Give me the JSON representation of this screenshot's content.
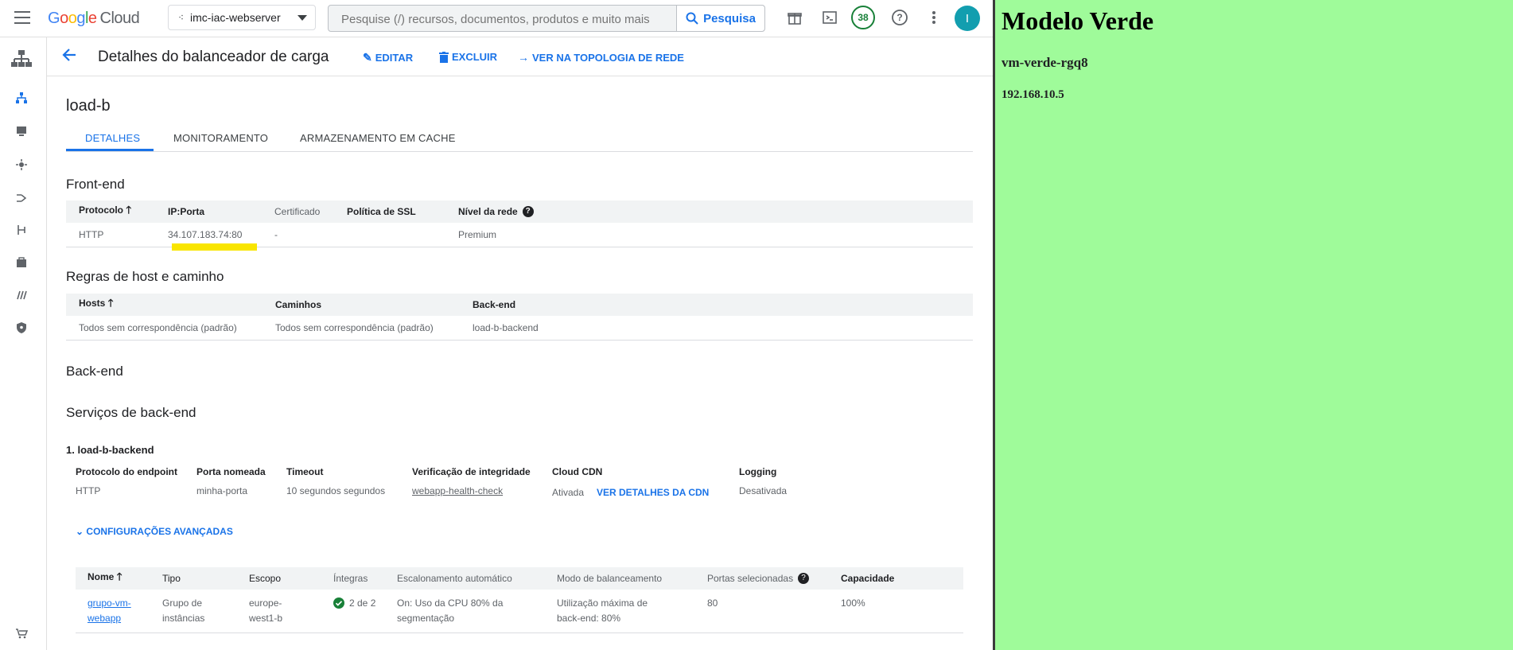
{
  "topbar": {
    "logo_google": "Google",
    "logo_cloud": "Cloud",
    "project": "imc-iac-webserver",
    "search_placeholder": "Pesquise (/) recursos, documentos, produtos e muito mais",
    "search_button": "Pesquisa",
    "notifications_count": "38",
    "avatar_letter": "I"
  },
  "header": {
    "title": "Detalhes do balanceador de carga",
    "edit": "EDITAR",
    "delete": "EXCLUIR",
    "topology": "VER NA TOPOLOGIA DE REDE"
  },
  "page": {
    "name": "load-b",
    "tabs": [
      "DETALHES",
      "MONITORAMENTO",
      "ARMAZENAMENTO EM CACHE"
    ]
  },
  "frontend": {
    "title": "Front-end",
    "headers": [
      "Protocolo",
      "IP:Porta",
      "Certificado",
      "Política de SSL",
      "Nível da rede"
    ],
    "row": [
      "HTTP",
      "34.107.183.74:80",
      "-",
      "",
      "Premium"
    ]
  },
  "hostrules": {
    "title": "Regras de host e caminho",
    "headers": [
      "Hosts",
      "Caminhos",
      "Back-end"
    ],
    "row": [
      "Todos sem correspondência (padrão)",
      "Todos sem correspondência (padrão)",
      "load-b-backend"
    ]
  },
  "backend": {
    "title": "Back-end",
    "services_title": "Serviços de back-end",
    "service_name": "1. load-b-backend",
    "headers": [
      "Protocolo do endpoint",
      "Porta nomeada",
      "Timeout",
      "Verificação de integridade",
      "Cloud CDN",
      "Logging"
    ],
    "values": [
      "HTTP",
      "minha-porta",
      "10 segundos segundos",
      "webapp-health-check",
      "Ativada",
      "Desativada"
    ],
    "cdn_link": "VER DETALHES DA CDN",
    "advanced": "CONFIGURAÇÕES AVANÇADAS"
  },
  "instances": {
    "headers": [
      "Nome",
      "Tipo",
      "Escopo",
      "Íntegras",
      "Escalonamento automático",
      "Modo de balanceamento",
      "Portas selecionadas",
      "Capacidade"
    ],
    "row": {
      "name": "grupo-vm-webapp",
      "type": "Grupo de instâncias",
      "scope": "europe-west1-b",
      "healthy": "2 de 2",
      "autoscale": "On: Uso da CPU 80% da segmentação",
      "mode": "Utilização máxima de back-end: 80%",
      "ports": "80",
      "capacity": "100%"
    }
  },
  "side_panel": {
    "title": "Modelo Verde",
    "vm": "vm-verde-rgq8",
    "ip": "192.168.10.5"
  }
}
